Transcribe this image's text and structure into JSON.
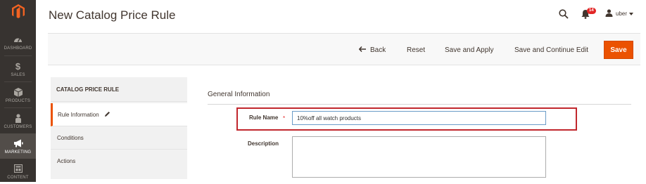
{
  "nav": {
    "items": [
      {
        "label": "DASHBOARD",
        "icon": "dashboard-icon"
      },
      {
        "label": "SALES",
        "icon": "dollar-icon"
      },
      {
        "label": "PRODUCTS",
        "icon": "cube-icon"
      },
      {
        "label": "CUSTOMERS",
        "icon": "person-icon"
      },
      {
        "label": "MARKETING",
        "icon": "megaphone-icon",
        "active": true
      },
      {
        "label": "CONTENT",
        "icon": "layout-icon"
      }
    ]
  },
  "header": {
    "title": "New Catalog Price Rule",
    "notifications_count": "14",
    "user": "uber"
  },
  "actions": {
    "back": "Back",
    "reset": "Reset",
    "save_apply": "Save and Apply",
    "save_continue": "Save and Continue Edit",
    "save": "Save"
  },
  "tabs": {
    "title": "CATALOG PRICE RULE",
    "items": [
      "Rule Information",
      "Conditions",
      "Actions"
    ]
  },
  "form": {
    "section": "General Information",
    "rule_name_label": "Rule Name",
    "required_mark": "*",
    "rule_name_value": "10%off all watch products",
    "description_label": "Description",
    "description_value": ""
  },
  "colors": {
    "accent": "#eb5202",
    "nav_bg": "#373330",
    "highlight": "#c1272d"
  }
}
